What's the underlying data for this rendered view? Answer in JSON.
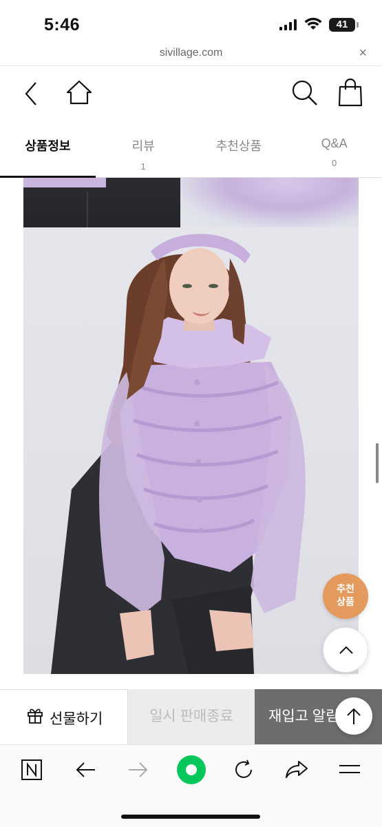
{
  "status_bar": {
    "time": "5:46",
    "battery": "41"
  },
  "browser": {
    "url": "sivillage.com",
    "close": "×"
  },
  "header": {
    "back": "back-icon",
    "home": "home-icon",
    "search": "search-icon",
    "cart": "shopping-bag-icon"
  },
  "tabs": [
    {
      "label": "상품정보",
      "count": "",
      "active": true
    },
    {
      "label": "리뷰",
      "count": "1",
      "active": false
    },
    {
      "label": "추천상품",
      "count": "",
      "active": false
    },
    {
      "label": "Q&A",
      "count": "0",
      "active": false
    }
  ],
  "floating": {
    "recommend_line1": "추천",
    "recommend_line2": "상품"
  },
  "action_bar": {
    "gift": "선물하기",
    "soldout": "일시 판매종료",
    "restock": "재입고 알림"
  },
  "colors": {
    "accent_orange": "#e39a5c",
    "restock_bg": "#6d6d6d",
    "naver_green": "#03c75a",
    "blouse_lavender": "#c6aede"
  }
}
